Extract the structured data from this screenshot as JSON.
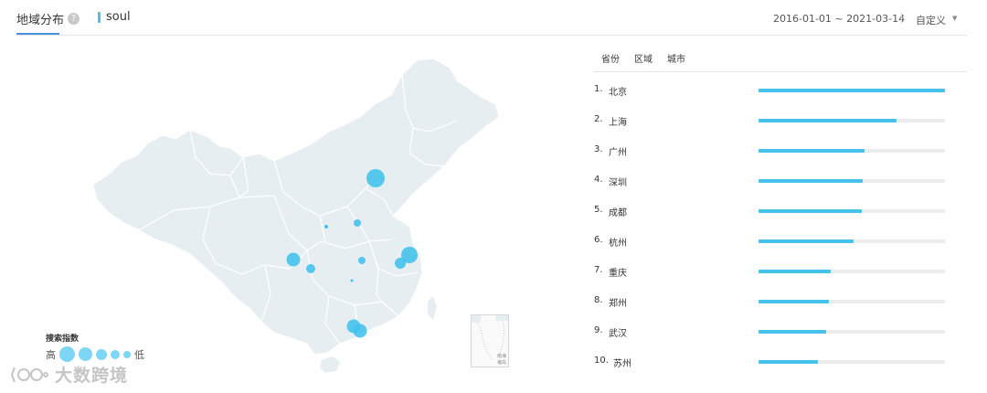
{
  "header": {
    "tab_label": "地域分布",
    "help_glyph": "?",
    "keyword": "soul",
    "date_range": "2016-01-01 ~ 2021-03-14",
    "date_mode": "自定义",
    "date_caret": "▼"
  },
  "ranking": {
    "tabs": [
      "省份",
      "区域",
      "城市"
    ],
    "items": [
      {
        "rank": "1.",
        "name": "北京",
        "value": 1.0
      },
      {
        "rank": "2.",
        "name": "上海",
        "value": 0.74
      },
      {
        "rank": "3.",
        "name": "广州",
        "value": 0.57
      },
      {
        "rank": "4.",
        "name": "深圳",
        "value": 0.56
      },
      {
        "rank": "5.",
        "name": "成都",
        "value": 0.555
      },
      {
        "rank": "6.",
        "name": "杭州",
        "value": 0.51
      },
      {
        "rank": "7.",
        "name": "重庆",
        "value": 0.385
      },
      {
        "rank": "8.",
        "name": "郑州",
        "value": 0.375
      },
      {
        "rank": "9.",
        "name": "武汉",
        "value": 0.365
      },
      {
        "rank": "10.",
        "name": "苏州",
        "value": 0.32
      }
    ]
  },
  "legend": {
    "title": "搜索指数",
    "high": "高",
    "low": "低"
  },
  "watermark": {
    "text": "大数跨境"
  },
  "inset": {
    "label_line1": "南海",
    "label_line2": "诸岛"
  },
  "colors": {
    "accent": "#45c2ec",
    "bubble": "#45c2ec",
    "map_fill": "#e6eef2",
    "map_border": "#ffffff",
    "tab_underline": "#4a90e2"
  }
}
